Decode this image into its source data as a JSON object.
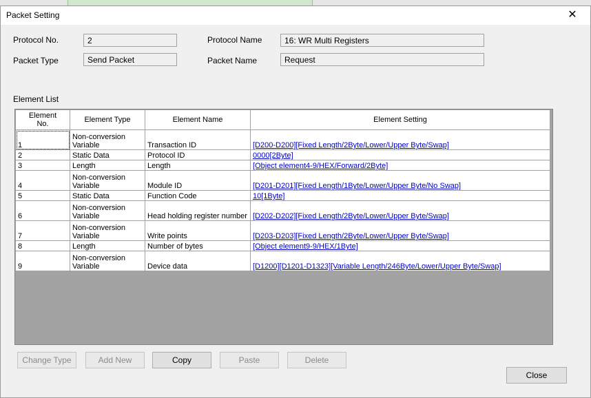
{
  "dialog": {
    "title": "Packet Setting"
  },
  "fields": {
    "protocol_no_label": "Protocol No.",
    "protocol_no": "2",
    "protocol_name_label": "Protocol Name",
    "protocol_name": "16: WR Multi Registers",
    "packet_type_label": "Packet Type",
    "packet_type": "Send Packet",
    "packet_name_label": "Packet Name",
    "packet_name": "Request"
  },
  "element_list": {
    "label": "Element List",
    "headers": [
      "Element\nNo.",
      "Element Type",
      "Element Name",
      "Element Setting"
    ],
    "rows": [
      {
        "no": "1",
        "type": "Non-conversion\nVariable",
        "name": "Transaction ID",
        "setting": "[D200-D200][Fixed Length/2Byte/Lower/Upper Byte/Swap]"
      },
      {
        "no": "2",
        "type": "Static Data",
        "name": "Protocol ID",
        "setting": "0000[2Byte]"
      },
      {
        "no": "3",
        "type": "Length",
        "name": "Length",
        "setting": "[Object element4-9/HEX/Forward/2Byte]"
      },
      {
        "no": "4",
        "type": "Non-conversion\nVariable",
        "name": "Module ID",
        "setting": "[D201-D201][Fixed Length/1Byte/Lower/Upper Byte/No Swap]"
      },
      {
        "no": "5",
        "type": "Static Data",
        "name": "Function Code",
        "setting": "10[1Byte]"
      },
      {
        "no": "6",
        "type": "Non-conversion\nVariable",
        "name": "Head holding register number",
        "setting": "[D202-D202][Fixed Length/2Byte/Lower/Upper Byte/Swap]"
      },
      {
        "no": "7",
        "type": "Non-conversion\nVariable",
        "name": "Write points",
        "setting": "[D203-D203][Fixed Length/2Byte/Lower/Upper Byte/Swap]"
      },
      {
        "no": "8",
        "type": "Length",
        "name": "Number of bytes",
        "setting": "[Object element9-9/HEX/1Byte]"
      },
      {
        "no": "9",
        "type": "Non-conversion\nVariable",
        "name": "Device data",
        "setting": "[D1200][D1201-D1323][Variable Length/246Byte/Lower/Upper Byte/Swap]"
      }
    ]
  },
  "buttons": {
    "change_type": "Change Type",
    "add_new": "Add New",
    "copy": "Copy",
    "paste": "Paste",
    "delete": "Delete",
    "close": "Close"
  },
  "colors": {
    "link": "#0000c8",
    "grid_background": "#a3a3a3"
  }
}
